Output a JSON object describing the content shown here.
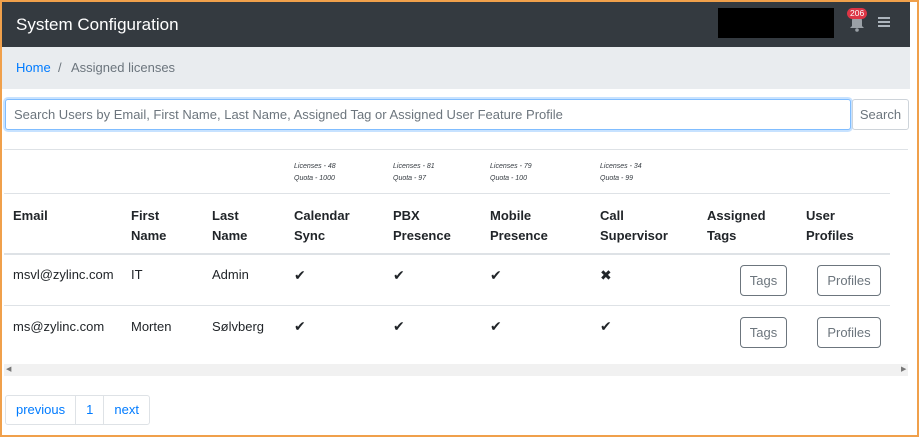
{
  "header": {
    "title": "System Configuration",
    "notification_count": "206"
  },
  "breadcrumb": {
    "home": "Home",
    "separator": "/",
    "current": "Assigned licenses"
  },
  "search": {
    "placeholder": "Search Users by Email, First Name, Last Name, Assigned Tag or Assigned User Feature Profile",
    "button_label": "Search"
  },
  "licenses": [
    {
      "licenses": "Licenses - 48",
      "quota": "Quota - 1000"
    },
    {
      "licenses": "Licenses - 81",
      "quota": "Quota - 97"
    },
    {
      "licenses": "Licenses - 79",
      "quota": "Quota - 100"
    },
    {
      "licenses": "Licenses - 34",
      "quota": "Quota - 99"
    }
  ],
  "table": {
    "headers": [
      {
        "line1": "Email",
        "line2": ""
      },
      {
        "line1": "First",
        "line2": "Name"
      },
      {
        "line1": "Last",
        "line2": "Name"
      },
      {
        "line1": "Calendar",
        "line2": "Sync"
      },
      {
        "line1": "PBX",
        "line2": "Presence"
      },
      {
        "line1": "Mobile",
        "line2": "Presence"
      },
      {
        "line1": "Call",
        "line2": "Supervisor"
      },
      {
        "line1": "Assigned",
        "line2": "Tags"
      },
      {
        "line1": "User",
        "line2": "Profiles"
      }
    ],
    "rows": [
      {
        "email": "msvl@zylinc.com",
        "first_name": "IT",
        "last_name": "Admin",
        "calendar_sync": "✔",
        "pbx_presence": "✔",
        "mobile_presence": "✔",
        "call_supervisor": "✖",
        "tags_button": "Tags",
        "profiles_button": "Profiles"
      },
      {
        "email": "ms@zylinc.com",
        "first_name": "Morten",
        "last_name": "Sølvberg",
        "calendar_sync": "✔",
        "pbx_presence": "✔",
        "mobile_presence": "✔",
        "call_supervisor": "✔",
        "tags_button": "Tags",
        "profiles_button": "Profiles"
      }
    ]
  },
  "pagination": {
    "previous": "previous",
    "page": "1",
    "next": "next"
  },
  "icons": {
    "notifications": "bell-icon",
    "menu": "hamburger-menu-icon",
    "scroll_left": "scroll-left-arrow-icon",
    "scroll_right": "scroll-right-arrow-icon"
  },
  "colors": {
    "header_bg": "#343a40",
    "breadcrumb_bg": "#e9ecef",
    "link": "#007bff",
    "badge": "#dc3545",
    "border_accent": "#f0a04b"
  }
}
